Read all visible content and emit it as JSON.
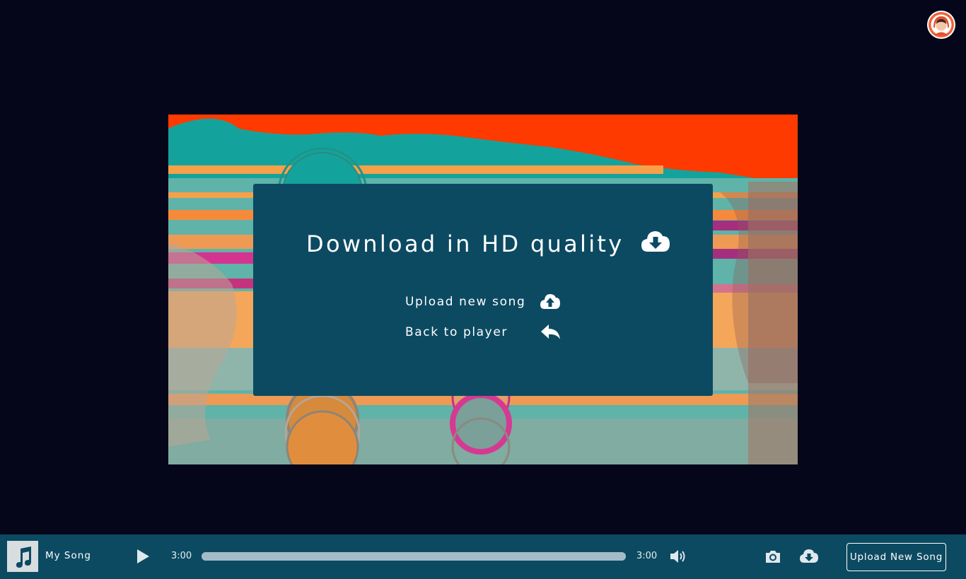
{
  "modal": {
    "title": "Download in HD quality",
    "title_icon": "cloud-download-icon",
    "options": [
      {
        "label": "Upload new song",
        "icon": "cloud-upload-icon"
      },
      {
        "label": "Back to player",
        "icon": "reply-arrow-icon"
      }
    ]
  },
  "user": {
    "avatar_icon": "user-avatar-icon"
  },
  "player": {
    "album_icon": "music-note-icon",
    "song_title": "My Song",
    "current_time": "3:00",
    "total_time": "3:00",
    "progress": 1.0,
    "upload_button_label": "Upload New Song"
  },
  "colors": {
    "background": "#05061a",
    "panel": "#0c4a62",
    "progress": "#a4bcc7",
    "accent_orange": "#ff3a00",
    "teal": "#10a89a"
  }
}
